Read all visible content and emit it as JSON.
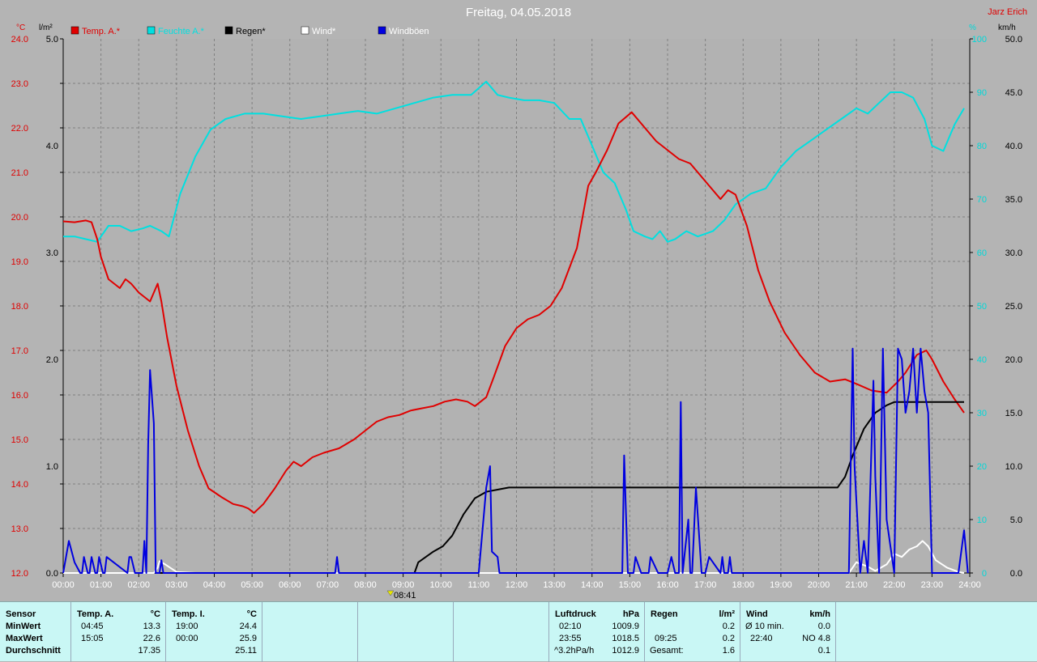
{
  "header": {
    "title": "Freitag, 04.05.2018",
    "author": "Jarz Erich",
    "unit_left_temp": "°C",
    "unit_left_rain": "l/m²",
    "unit_right_pct": "%",
    "unit_right_kmh": "km/h"
  },
  "legend": [
    {
      "label": "Temp. A.*",
      "color": "#e00000"
    },
    {
      "label": "Feuchte A.*",
      "color": "#00e0e0"
    },
    {
      "label": "Regen*",
      "color": "#000000"
    },
    {
      "label": "Wind*",
      "color": "#ffffff"
    },
    {
      "label": "Windböen",
      "color": "#0000e0"
    }
  ],
  "marker": {
    "label": "08:41"
  },
  "chart_data": {
    "type": "line",
    "title": "Freitag, 04.05.2018",
    "x_unit": "hours",
    "xlim": [
      0,
      24
    ],
    "x_tick_labels": [
      "00:00",
      "01:00",
      "02:00",
      "03:00",
      "04:00",
      "05:00",
      "06:00",
      "07:00",
      "08:00",
      "09:00",
      "10:00",
      "11:00",
      "12:00",
      "13:00",
      "14:00",
      "15:00",
      "16:00",
      "17:00",
      "18:00",
      "19:00",
      "20:00",
      "21:00",
      "22:00",
      "23:00",
      "24:00"
    ],
    "axes": {
      "temp": {
        "label": "°C",
        "lim": [
          12,
          24
        ],
        "ticks": [
          "12.0",
          "13.0",
          "14.0",
          "15.0",
          "16.0",
          "17.0",
          "18.0",
          "19.0",
          "20.0",
          "21.0",
          "22.0",
          "23.0",
          "24.0"
        ],
        "color": "#e00000"
      },
      "rain": {
        "label": "l/m²",
        "lim": [
          0,
          5
        ],
        "ticks": [
          "0.0",
          "1.0",
          "2.0",
          "3.0",
          "4.0",
          "5.0"
        ],
        "color": "#000000"
      },
      "humidity": {
        "label": "%",
        "lim": [
          0,
          100
        ],
        "ticks": [
          "0",
          "10",
          "20",
          "30",
          "40",
          "50",
          "60",
          "70",
          "80",
          "90",
          "100"
        ],
        "color": "#00d8d8"
      },
      "wind": {
        "label": "km/h",
        "lim": [
          0,
          50
        ],
        "ticks": [
          "0.0",
          "5.0",
          "10.0",
          "15.0",
          "20.0",
          "25.0",
          "30.0",
          "35.0",
          "40.0",
          "45.0",
          "50.0"
        ],
        "color": "#000000"
      }
    },
    "grid": true,
    "series": [
      {
        "name": "Temp. A.*",
        "axis": "temp",
        "color": "#e00000",
        "x": [
          0,
          0.3,
          0.6,
          0.75,
          0.9,
          1.0,
          1.2,
          1.5,
          1.65,
          1.8,
          2.0,
          2.3,
          2.5,
          2.6,
          2.75,
          3.0,
          3.3,
          3.6,
          3.85,
          4.2,
          4.5,
          4.75,
          4.9,
          5.05,
          5.3,
          5.6,
          5.9,
          6.1,
          6.3,
          6.6,
          6.9,
          7.3,
          7.7,
          8.0,
          8.3,
          8.6,
          8.9,
          9.2,
          9.5,
          9.8,
          10.1,
          10.4,
          10.7,
          10.9,
          11.2,
          11.4,
          11.7,
          12.0,
          12.3,
          12.6,
          12.9,
          13.2,
          13.6,
          13.9,
          14.1,
          14.4,
          14.7,
          15.05,
          15.3,
          15.7,
          16.0,
          16.3,
          16.6,
          16.9,
          17.1,
          17.4,
          17.6,
          17.8,
          18.1,
          18.4,
          18.7,
          19.1,
          19.5,
          19.9,
          20.3,
          20.7,
          21.0,
          21.4,
          21.8,
          22.1,
          22.3,
          22.6,
          22.85,
          23.0,
          23.3,
          23.6,
          23.85
        ],
        "values": [
          19.9,
          19.88,
          19.92,
          19.88,
          19.5,
          19.1,
          18.6,
          18.4,
          18.6,
          18.5,
          18.3,
          18.1,
          18.5,
          18.1,
          17.3,
          16.2,
          15.2,
          14.4,
          13.9,
          13.7,
          13.55,
          13.5,
          13.45,
          13.35,
          13.55,
          13.9,
          14.3,
          14.5,
          14.4,
          14.6,
          14.7,
          14.8,
          15.0,
          15.2,
          15.4,
          15.5,
          15.55,
          15.65,
          15.7,
          15.75,
          15.85,
          15.9,
          15.85,
          15.75,
          15.95,
          16.4,
          17.1,
          17.5,
          17.7,
          17.8,
          18.0,
          18.4,
          19.3,
          20.7,
          21.0,
          21.5,
          22.1,
          22.35,
          22.1,
          21.7,
          21.5,
          21.3,
          21.2,
          20.9,
          20.7,
          20.4,
          20.6,
          20.5,
          19.8,
          18.8,
          18.1,
          17.4,
          16.9,
          16.5,
          16.3,
          16.35,
          16.25,
          16.1,
          16.05,
          16.3,
          16.5,
          16.9,
          17.0,
          16.8,
          16.3,
          15.9,
          15.6
        ]
      },
      {
        "name": "Feuchte A.*",
        "axis": "humidity",
        "color": "#00e0e0",
        "x": [
          0,
          0.3,
          0.6,
          0.9,
          1.2,
          1.5,
          1.8,
          2.1,
          2.3,
          2.6,
          2.8,
          3.1,
          3.5,
          3.9,
          4.3,
          4.8,
          5.3,
          5.8,
          6.3,
          6.8,
          7.3,
          7.8,
          8.3,
          8.8,
          9.3,
          9.8,
          10.3,
          10.8,
          11.2,
          11.5,
          11.8,
          12.2,
          12.6,
          13.0,
          13.4,
          13.7,
          14.0,
          14.3,
          14.6,
          14.9,
          15.1,
          15.4,
          15.6,
          15.8,
          16.0,
          16.2,
          16.5,
          16.8,
          17.2,
          17.5,
          17.8,
          18.2,
          18.6,
          19.0,
          19.4,
          19.8,
          20.2,
          20.6,
          21.0,
          21.3,
          21.6,
          21.9,
          22.2,
          22.5,
          22.8,
          23.0,
          23.3,
          23.6,
          23.85
        ],
        "values": [
          63,
          63,
          62.5,
          62,
          65,
          65,
          64,
          64.5,
          65,
          64,
          63,
          71,
          78,
          83,
          85,
          86,
          86,
          85.5,
          85,
          85.5,
          86,
          86.5,
          86,
          87,
          88,
          89,
          89.5,
          89.5,
          92,
          89.5,
          89,
          88.5,
          88.5,
          88,
          85,
          85,
          80,
          75,
          73,
          68,
          64,
          63,
          62.5,
          64,
          62,
          62.5,
          64,
          63,
          64,
          66,
          69,
          71,
          72,
          76,
          79,
          81,
          83,
          85,
          87,
          86,
          88,
          90,
          90,
          89,
          85,
          80,
          79,
          84,
          87
        ]
      },
      {
        "name": "Regen*",
        "axis": "rain",
        "color": "#000000",
        "x": [
          0,
          9.3,
          9.4,
          9.6,
          9.8,
          10.05,
          10.3,
          10.6,
          10.9,
          11.2,
          11.5,
          11.8,
          12.0,
          12.5,
          13.0,
          14.0,
          15.0,
          16.0,
          17.0,
          18.0,
          19.0,
          20.0,
          20.3,
          20.5,
          20.7,
          20.9,
          21.2,
          21.5,
          21.8,
          22.0,
          22.2,
          22.5,
          23.0,
          23.5,
          23.85
        ],
        "values": [
          0,
          0,
          0.1,
          0.15,
          0.2,
          0.25,
          0.35,
          0.55,
          0.7,
          0.76,
          0.78,
          0.8,
          0.8,
          0.8,
          0.8,
          0.8,
          0.8,
          0.8,
          0.8,
          0.8,
          0.8,
          0.8,
          0.8,
          0.8,
          0.9,
          1.1,
          1.35,
          1.5,
          1.57,
          1.6,
          1.6,
          1.6,
          1.6,
          1.6,
          1.6
        ]
      },
      {
        "name": "Wind*",
        "axis": "wind",
        "color": "#ffffff",
        "x": [
          0,
          2.4,
          2.5,
          2.55,
          2.7,
          3.0,
          3.5,
          4.0,
          20.8,
          21.0,
          21.3,
          21.5,
          21.8,
          22.0,
          22.2,
          22.4,
          22.6,
          22.75,
          22.9,
          23.1,
          23.4,
          23.7,
          23.85
        ],
        "values": [
          0,
          0,
          0.5,
          1.1,
          0.8,
          0.1,
          0,
          0,
          0,
          1,
          0.6,
          0.2,
          0.8,
          1.8,
          1.5,
          2.2,
          2.5,
          3.0,
          2.5,
          1.2,
          0.5,
          0.1,
          0
        ]
      },
      {
        "name": "Windböen",
        "axis": "wind",
        "color": "#0000e0",
        "x": [
          0,
          0.15,
          0.3,
          0.45,
          0.5,
          0.55,
          0.65,
          0.7,
          0.75,
          0.85,
          0.9,
          0.95,
          1.05,
          1.1,
          1.15,
          1.7,
          1.75,
          1.8,
          1.9,
          2.1,
          2.15,
          2.2,
          2.25,
          2.3,
          2.4,
          2.45,
          2.55,
          2.6,
          2.65,
          7.2,
          7.25,
          7.3,
          11.0,
          11.2,
          11.3,
          11.35,
          11.5,
          11.55,
          14.8,
          14.85,
          14.95,
          15.1,
          15.15,
          15.3,
          15.5,
          15.55,
          15.75,
          16.0,
          16.1,
          16.2,
          16.3,
          16.35,
          16.4,
          16.55,
          16.6,
          16.65,
          16.75,
          16.9,
          17.0,
          17.1,
          17.4,
          17.45,
          17.5,
          17.6,
          17.65,
          17.7,
          20.8,
          20.9,
          20.95,
          21.1,
          21.2,
          21.3,
          21.45,
          21.5,
          21.6,
          21.7,
          21.8,
          22.0,
          22.1,
          22.2,
          22.3,
          22.4,
          22.5,
          22.6,
          22.7,
          22.8,
          22.9,
          23.0,
          23.1,
          23.2,
          23.7,
          23.85,
          23.95
        ],
        "values": [
          0,
          3,
          1,
          0,
          0,
          1.5,
          0,
          0,
          1.5,
          0,
          0,
          1.5,
          0,
          0,
          1.5,
          0,
          1.5,
          1.5,
          0,
          0,
          3,
          0,
          12,
          19,
          14,
          0,
          0,
          1.2,
          0,
          0,
          1.5,
          0,
          0,
          8,
          10,
          2,
          1.5,
          0,
          0,
          11,
          0,
          0,
          1.5,
          0,
          0,
          1.5,
          0,
          0,
          1.5,
          0,
          0,
          16,
          0,
          5,
          0,
          0,
          8,
          0,
          0,
          1.5,
          0,
          1.5,
          0,
          0,
          1.5,
          0,
          0,
          21,
          10,
          0,
          3,
          0,
          18,
          9,
          0,
          21,
          5,
          0,
          21,
          20,
          15,
          17,
          21,
          15,
          21,
          17,
          15,
          0,
          0,
          0,
          0,
          4,
          0
        ]
      }
    ]
  },
  "stats": {
    "sensor": {
      "header": "Sensor",
      "min": "MinWert",
      "max": "MaxWert",
      "avg": "Durchschnitt"
    },
    "temp_a": {
      "name": "Temp. A.",
      "unit": "°C",
      "min_time": "04:45",
      "min_val": "13.3",
      "max_time": "15:05",
      "max_val": "22.6",
      "avg_val": "17.35"
    },
    "temp_i": {
      "name": "Temp. I.",
      "unit": "°C",
      "min_time": "19:00",
      "min_val": "24.4",
      "max_time": "00:00",
      "max_val": "25.9",
      "avg_val": "25.11"
    },
    "pressure": {
      "name": "Luftdruck",
      "unit": "hPa",
      "min_time": "02:10",
      "min_val": "1009.9",
      "max_time": "23:55",
      "max_val": "1018.5",
      "avg_label": "^3.2hPa/h",
      "avg_val": "1012.9"
    },
    "rain": {
      "name": "Regen",
      "unit": "l/m²",
      "min_val": "0.2",
      "max_time": "09:25",
      "max_val": "0.2",
      "total_label": "Gesamt:",
      "total_val": "1.6"
    },
    "wind": {
      "name": "Wind",
      "unit": "km/h",
      "min_label": "Ø 10 min.",
      "min_val": "0.0",
      "max_time": "22:40",
      "max_val": "NO 4.8",
      "avg_val": "0.1"
    }
  }
}
